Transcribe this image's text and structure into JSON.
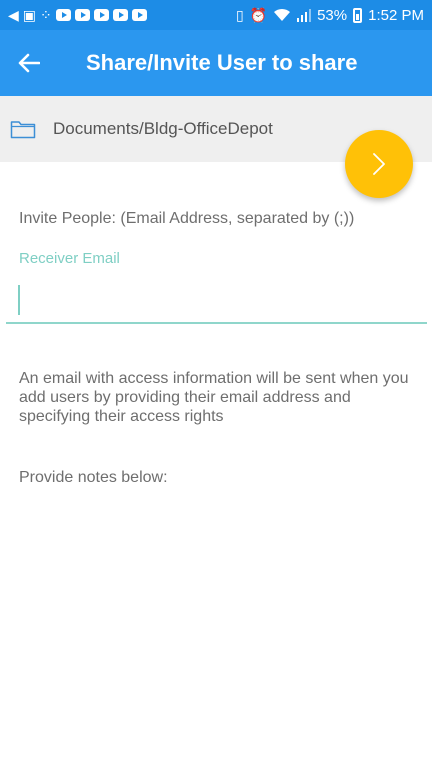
{
  "status_bar": {
    "battery": "53%",
    "time": "1:52 PM",
    "icons": [
      "back-nav-icon",
      "gallery-icon",
      "apps-icon",
      "youtube-icon",
      "youtube-icon",
      "youtube-icon",
      "youtube-icon",
      "youtube-icon",
      "vibrate-icon",
      "alarm-icon",
      "wifi-icon",
      "signal-icon",
      "battery-icon"
    ]
  },
  "app_bar": {
    "title": "Share/Invite User to share",
    "back_icon": "arrow-left-icon"
  },
  "path": {
    "icon": "folder-icon",
    "text": "Documents/Bldg-OfficeDepot"
  },
  "fab": {
    "icon": "chevron-right-icon"
  },
  "form": {
    "invite_label": "Invite People: (Email Address, separated by (;))",
    "receiver_label": "Receiver Email",
    "email_value": "",
    "info_text": "An email with access information will be sent when you add users by providing their email address and specifying their access rights",
    "notes_label": "Provide notes below:",
    "notes_value": ""
  },
  "colors": {
    "status_bar": "#1d8ce6",
    "app_bar": "#2b97ef",
    "accent_teal": "#7fcfc4",
    "fab": "#ffc107",
    "path_row": "#efefef"
  }
}
